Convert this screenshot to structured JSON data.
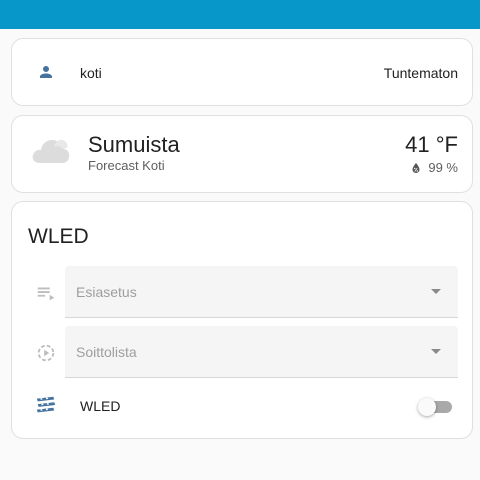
{
  "colors": {
    "header": "#0797c9",
    "person_icon": "#44739e",
    "cloud_icon": "#dcdcdc",
    "wled_icon": "#44739e"
  },
  "person_card": {
    "icon": "account-icon",
    "name": "koti",
    "state": "Tuntematon"
  },
  "weather_card": {
    "icon": "fog-cloud-icon",
    "condition": "Sumuista",
    "entity_name": "Forecast Koti",
    "temperature": "41 °F",
    "humidity": "99 %",
    "humidity_icon": "water-percent-icon"
  },
  "wled_card": {
    "title": "WLED",
    "preset": {
      "icon": "playlist-play-icon",
      "label": "Esiasetus"
    },
    "playlist": {
      "icon": "play-speed-icon",
      "label": "Soittolista"
    },
    "light": {
      "icon": "led-strip-icon",
      "label": "WLED",
      "on": false
    }
  }
}
